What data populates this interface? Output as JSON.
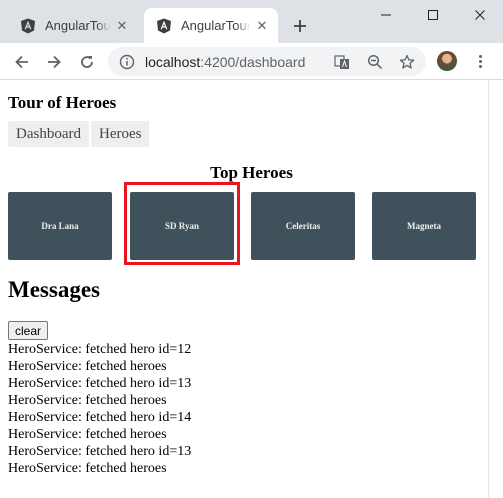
{
  "browser": {
    "tabs": [
      {
        "title": "AngularTourOfHeroes",
        "active": false,
        "icon": "angular-icon"
      },
      {
        "title": "AngularTourOfHeroes",
        "active": true,
        "icon": "angular-icon"
      }
    ],
    "url_host": "localhost",
    "url_rest": ":4200/dashboard"
  },
  "app": {
    "title": "Tour of Heroes",
    "nav": [
      {
        "label": "Dashboard"
      },
      {
        "label": "Heroes"
      }
    ]
  },
  "dashboard": {
    "title": "Top Heroes",
    "heroes": [
      {
        "name": "Dra Lana",
        "highlighted": false
      },
      {
        "name": "SD Ryan",
        "highlighted": true
      },
      {
        "name": "Celeritas",
        "highlighted": false
      },
      {
        "name": "Magneta",
        "highlighted": false
      }
    ],
    "highlight_color": "#e8151f"
  },
  "messages": {
    "title": "Messages",
    "clear_label": "clear",
    "items": [
      "HeroService: fetched hero id=12",
      "HeroService: fetched heroes",
      "HeroService: fetched hero id=13",
      "HeroService: fetched heroes",
      "HeroService: fetched hero id=14",
      "HeroService: fetched heroes",
      "HeroService: fetched hero id=13",
      "HeroService: fetched heroes"
    ]
  }
}
